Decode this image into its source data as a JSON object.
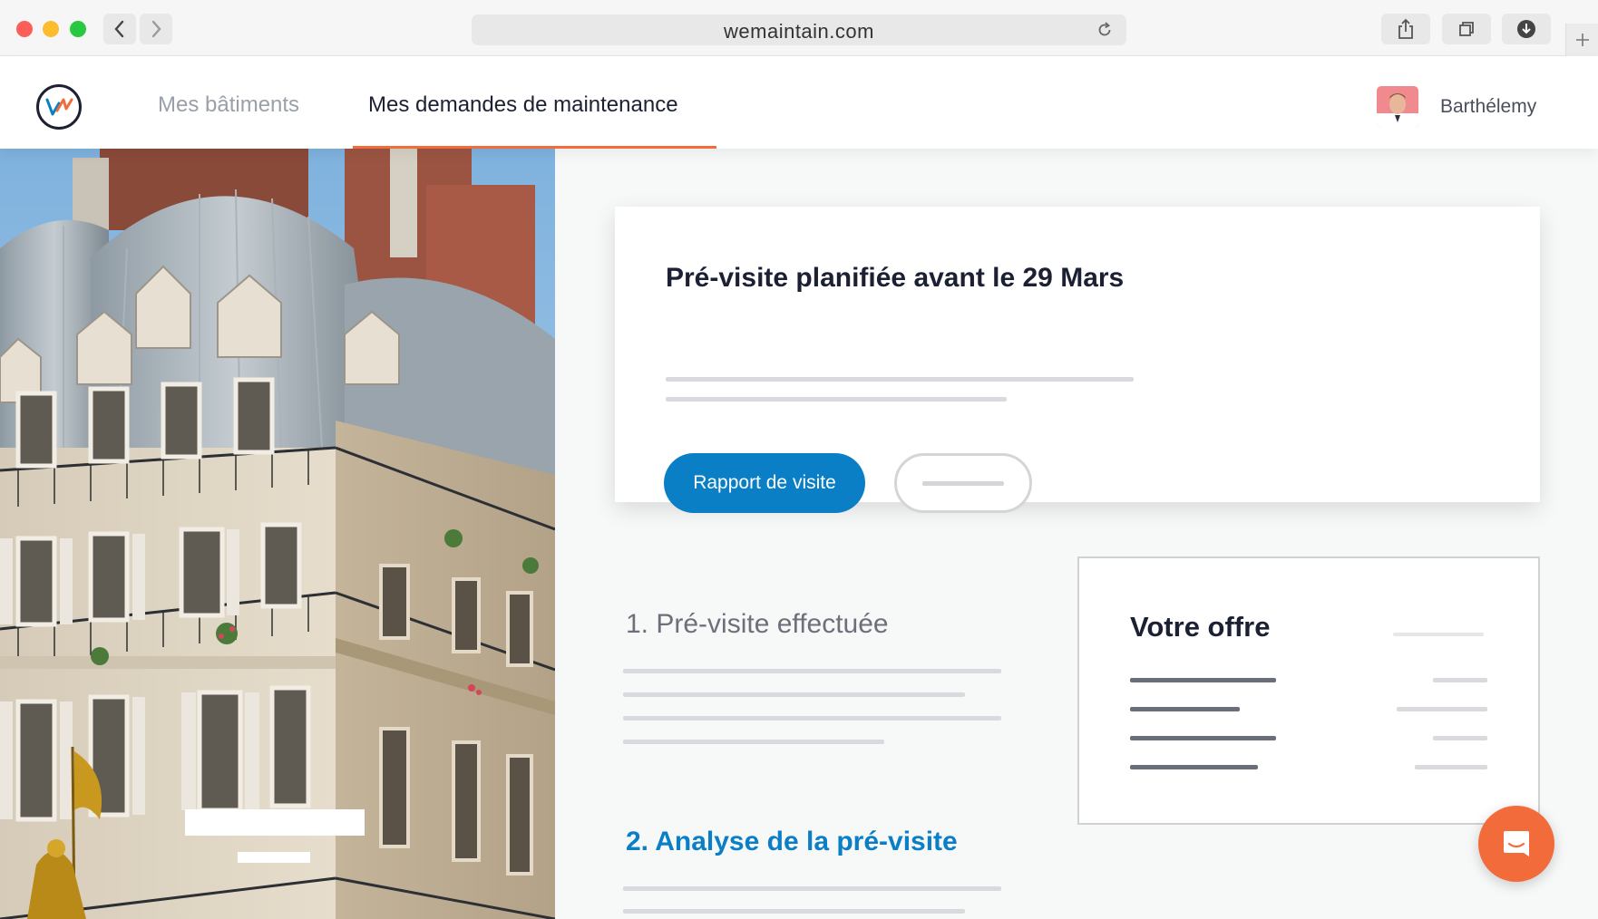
{
  "browser": {
    "url": "wemaintain.com"
  },
  "nav": {
    "items": [
      {
        "label": "Mes bâtiments"
      },
      {
        "label": "Mes demandes de maintenance",
        "active": true
      }
    ]
  },
  "user": {
    "name": "Barthélemy"
  },
  "card": {
    "title": "Pré-visite planifiée avant le 29 Mars",
    "primary_button": "Rapport de visite"
  },
  "steps": [
    {
      "label": "1. Pré-visite effectuée",
      "state": "done"
    },
    {
      "label": "2. Analyse de la pré-visite",
      "state": "current"
    }
  ],
  "offer": {
    "title": "Votre offre"
  },
  "colors": {
    "accent": "#0a7fc6",
    "brand_orange": "#f26b3a",
    "text_dark": "#1c2033"
  },
  "icons": {
    "back": "chevron-left-icon",
    "forward": "chevron-right-icon",
    "reload": "reload-icon",
    "share": "share-icon",
    "tabs": "tabs-icon",
    "download": "download-icon",
    "new_tab": "plus-icon",
    "chat": "chat-icon"
  }
}
